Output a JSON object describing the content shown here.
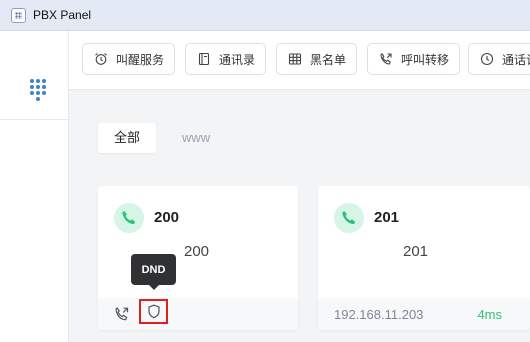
{
  "window": {
    "title": "PBX Panel",
    "icon": "app-icon"
  },
  "sidebar": {
    "icon": "dialpad-icon"
  },
  "toolbar": {
    "buttons": [
      {
        "label": "叫醒服务",
        "icon": "alarm-clock-icon"
      },
      {
        "label": "通讯录",
        "icon": "contacts-book-icon"
      },
      {
        "label": "黑名单",
        "icon": "blacklist-icon"
      },
      {
        "label": "呼叫转移",
        "icon": "call-forward-icon"
      },
      {
        "label": "通话记",
        "icon": "clock-icon"
      }
    ]
  },
  "tabs": [
    {
      "label": "全部",
      "active": true
    },
    {
      "label": "www",
      "active": false
    }
  ],
  "extensions": [
    {
      "number": "200",
      "name": "200",
      "footer_icons": [
        "call-forward-icon",
        "shield-icon"
      ]
    },
    {
      "number": "201",
      "name": "201",
      "ip": "192.168.11.203",
      "latency": "4ms"
    }
  ],
  "tooltip": {
    "text": "DND"
  },
  "colors": {
    "accent_green": "#2fc27a",
    "phone_badge_bg": "#d6f5e6",
    "highlight_red": "#e02020",
    "dialpad_blue": "#3d84c6"
  }
}
